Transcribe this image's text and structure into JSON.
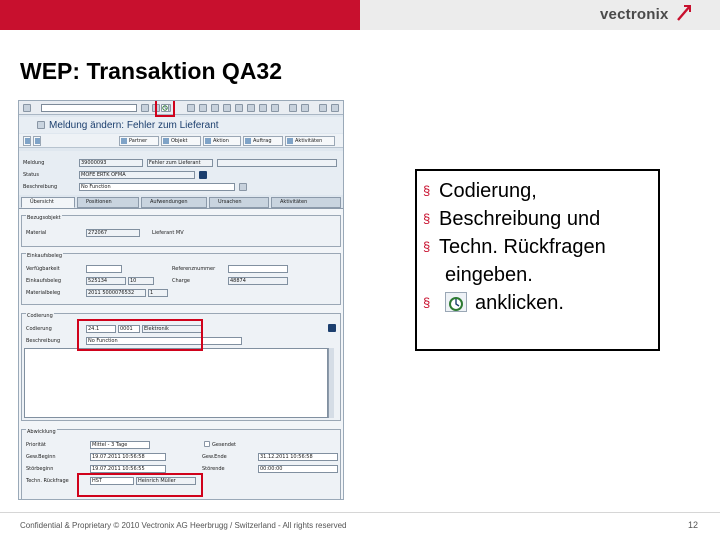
{
  "slide": {
    "title": "WEP: Transaktion QA32",
    "logo_text": "vectronix",
    "footer": "Confidential & Proprietary © 2010 Vectronix AG Heerbrugg / Switzerland - All rights reserved",
    "page_number": "12",
    "brand_color": "#c8102e"
  },
  "callout": {
    "items": [
      {
        "bullet": "§",
        "text": "Codierung,"
      },
      {
        "bullet": "§",
        "text": "Beschreibung und"
      },
      {
        "bullet": "§",
        "text": "Techn. Rückfragen"
      },
      {
        "bullet": "",
        "text": "eingeben."
      },
      {
        "bullet": "§",
        "text": "anklicken.",
        "icon": "execute-icon"
      }
    ]
  },
  "sap": {
    "window_title": "Meldung ändern: Fehler zum Lieferant",
    "toolbar_icons": [
      "enter-icon",
      "save-icon",
      "back-icon",
      "exit-icon",
      "cancel-icon",
      "print-icon",
      "find-icon",
      "execute-icon"
    ],
    "app_buttons": [
      "Partner",
      "Objekt",
      "Aktion",
      "Auftrag",
      "Aktivitäten"
    ],
    "header": {
      "meldung_label": "Meldung",
      "meldung_value": "39000093",
      "meldungsart": "Fehler zum Lieferant",
      "status_label": "Status",
      "status_value": "MOFE ERTK OFMA",
      "beschreibung_label": "Beschreibung",
      "beschreibung_value": "No Function"
    },
    "tabs": [
      "Übersicht",
      "Positionen",
      "Aufwendungen",
      "Ursachen",
      "Aktivitäten"
    ],
    "groups": {
      "bezugsobjekt": {
        "title": "Bezugsobjekt",
        "material_label": "Material",
        "material_value": "272067",
        "lieferant_label": "Lieferant MV"
      },
      "einkauf": {
        "title": "Einkaufsbeleg",
        "verfuegbarkeit_label": "Verfügbarkeit",
        "einkaufsbeleg_label": "Einkaufsbeleg",
        "einkaufsbeleg_value": "525134",
        "einkaufsbeleg_pos": "10",
        "materialbeleg_label": "Materialbeleg",
        "materialbeleg_value": "2011 5000076532",
        "materialbeleg_pos": "1",
        "referenz_label": "Referenznummer",
        "charge_label": "Charge",
        "charge_value": "48874"
      },
      "codierung": {
        "title": "Codierung",
        "codierung_label": "Codierung",
        "codierung_value": "24.1",
        "codierung_code": "0001",
        "codierung_text": "Elektronik",
        "beschreibung_label": "Beschreibung",
        "beschreibung_value": "No Function"
      },
      "abwicklung": {
        "title": "Abwicklung",
        "prioritaet_label": "Priorität",
        "prioritaet_value": "Mittel - 3 Tage",
        "gewbeginn_label": "Gew.Beginn",
        "gewbeginn_value": "19.07.2011 10:56:58",
        "stoebeginn_label": "Störbeginn",
        "stoebeginn_value": "19.07.2011 10:56:55",
        "rueckfrage_label": "Techn. Rückfrage",
        "rueckfrage_value": "HST",
        "rueckfrage_name": "Heinrich Müller",
        "gewende_label": "Gew.Ende",
        "gewende_value": "31.12.2011 10:56:58",
        "stoeende_label": "Störende",
        "stoeende_value": "00:00:00",
        "gesendet_label": "Gesendet"
      }
    }
  }
}
